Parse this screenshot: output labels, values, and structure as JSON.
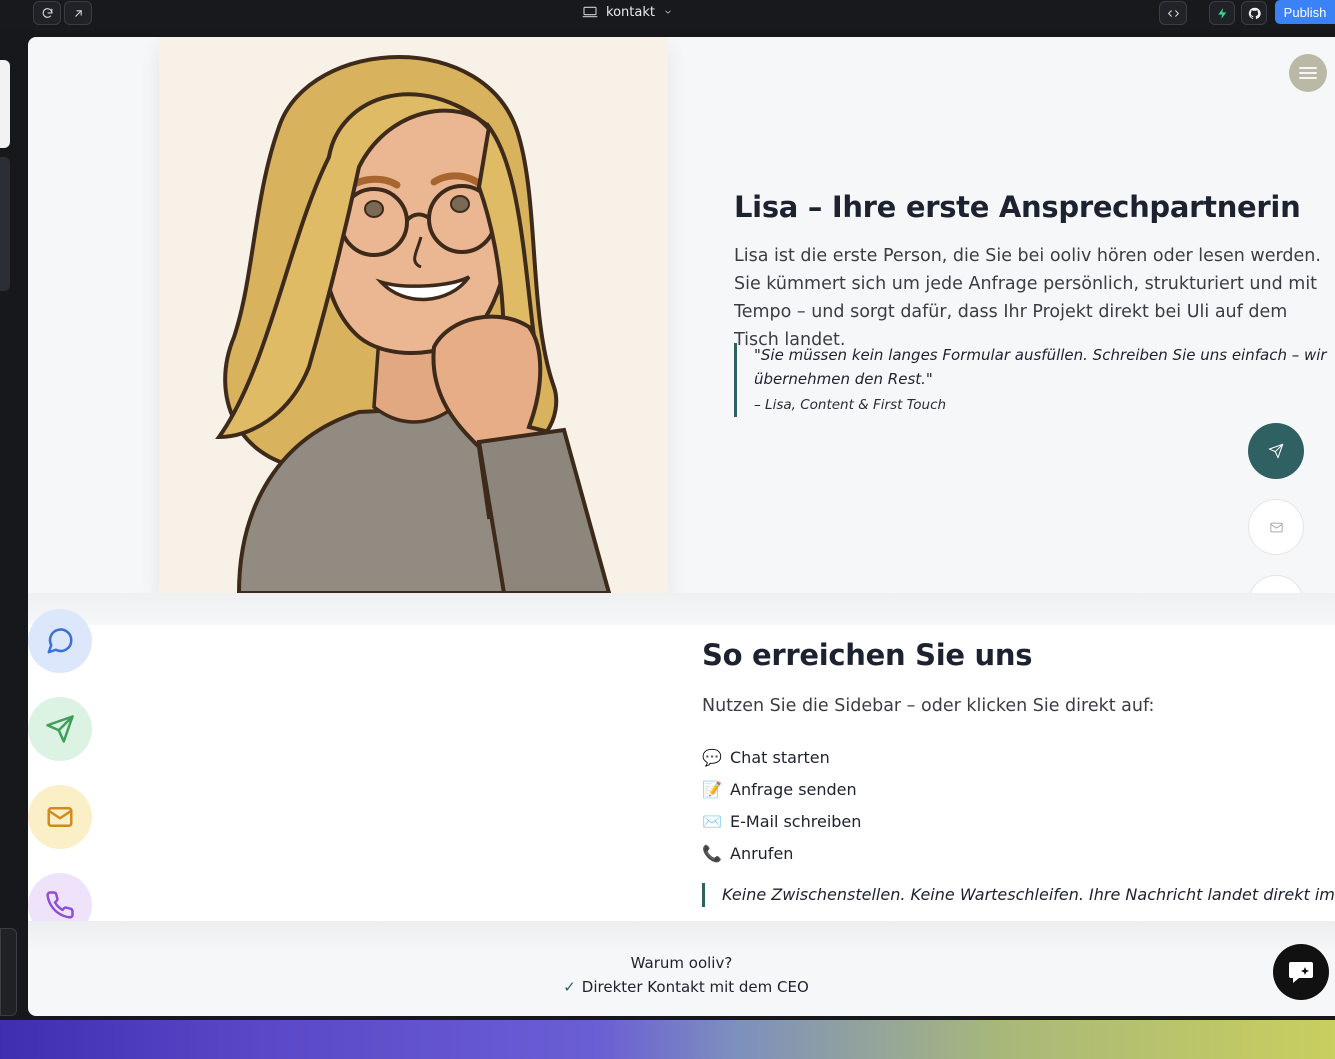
{
  "topbar": {
    "page_name": "kontakt",
    "publish_label": "Publish",
    "icons": [
      "refresh-icon",
      "external-link-icon",
      "monitor-icon",
      "chevron-down-icon",
      "code-icon",
      "bolt-icon",
      "github-icon"
    ]
  },
  "colors": {
    "accent": "#2f6062",
    "publish": "#3b82f6",
    "heading": "#1d2230"
  },
  "lisa": {
    "title": "Lisa – Ihre erste Ansprechpartnerin",
    "description": "Lisa ist die erste Person, die Sie bei ooliv hören oder lesen werden. Sie kümmert sich um jede Anfrage persönlich, strukturiert und mit Tempo – und sorgt dafür, dass Ihr Projekt direkt bei Uli auf dem Tisch landet.",
    "quote": "\"Sie müssen kein langes Formular ausfüllen. Schreiben Sie uns einfach – wir übernehmen den Rest.\"",
    "quote_author": "– Lisa, Content & First Touch"
  },
  "reach": {
    "title": "So erreichen Sie uns",
    "subtitle": "Nutzen Sie die Sidebar – oder klicken Sie direkt auf:",
    "items": [
      {
        "emoji": "💬",
        "label": "Chat starten"
      },
      {
        "emoji": "📝",
        "label": "Anfrage senden"
      },
      {
        "emoji": "✉️",
        "label": "E-Mail schreiben"
      },
      {
        "emoji": "📞",
        "label": "Anrufen"
      }
    ],
    "note": "Keine Zwischenstellen. Keine Warteschleifen. Ihre Nachricht landet direkt im Team."
  },
  "why": {
    "title": "Warum ooliv?",
    "check": "✓",
    "point": "Direkter Kontakt mit dem CEO"
  }
}
